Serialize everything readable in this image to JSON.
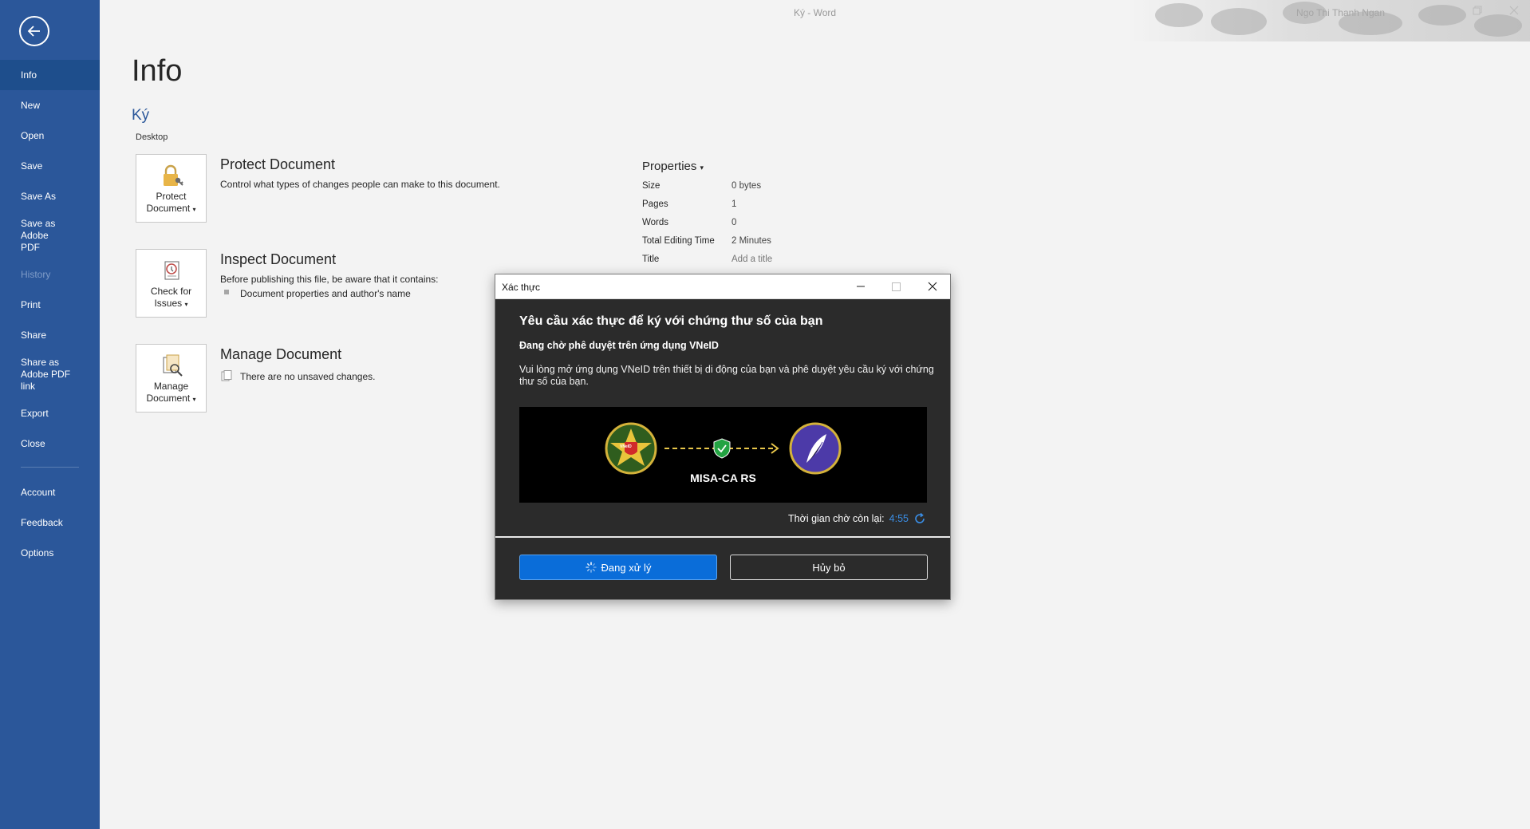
{
  "window": {
    "title": "Ký  -  Word",
    "user": "Ngo Thi Thanh Ngan"
  },
  "nav": {
    "items": [
      {
        "label": "Info",
        "active": true
      },
      {
        "label": "New"
      },
      {
        "label": "Open"
      },
      {
        "label": "Save"
      },
      {
        "label": "Save As"
      },
      {
        "label": "Save as Adobe PDF"
      },
      {
        "label": "History",
        "disabled": true
      },
      {
        "label": "Print"
      },
      {
        "label": "Share"
      },
      {
        "label": "Share as Adobe PDF link"
      },
      {
        "label": "Export"
      },
      {
        "label": "Close"
      }
    ],
    "bottom_items": [
      {
        "label": "Account"
      },
      {
        "label": "Feedback"
      },
      {
        "label": "Options"
      }
    ]
  },
  "info": {
    "page_title": "Info",
    "doc_name": "Ký",
    "doc_location": "Desktop",
    "protect": {
      "tile_line1": "Protect",
      "tile_line2": "Document",
      "title": "Protect Document",
      "desc": "Control what types of changes people can make to this document."
    },
    "inspect": {
      "tile_line1": "Check for",
      "tile_line2": "Issues",
      "title": "Inspect Document",
      "desc": "Before publishing this file, be aware that it contains:",
      "bullet": "Document properties and author's name"
    },
    "manage": {
      "tile_line1": "Manage",
      "tile_line2": "Document",
      "title": "Manage Document",
      "desc": "There are no unsaved changes."
    }
  },
  "properties": {
    "heading": "Properties",
    "rows": [
      {
        "label": "Size",
        "value": "0 bytes"
      },
      {
        "label": "Pages",
        "value": "1"
      },
      {
        "label": "Words",
        "value": "0"
      },
      {
        "label": "Total Editing Time",
        "value": "2 Minutes"
      },
      {
        "label": "Title",
        "value": "Add a title"
      }
    ]
  },
  "dialog": {
    "title": "Xác thực",
    "heading": "Yêu cầu xác thực để ký với chứng thư số của bạn",
    "subheading": "Đang chờ phê duyệt trên ứng dụng VNeID",
    "body": "Vui lòng mở ứng dụng VNeID trên thiết bị di động của bạn và phê duyệt yêu cầu ký với chứng thư số của bạn.",
    "banner_label": "MISA-CA RS",
    "emblem_text": "VNeID",
    "timer_label": "Thời gian chờ còn lại:",
    "timer_value": "4:55",
    "primary_button": "Đang xử lý",
    "cancel_button": "Hủy bỏ",
    "accent_color": "#0a6dd9"
  }
}
